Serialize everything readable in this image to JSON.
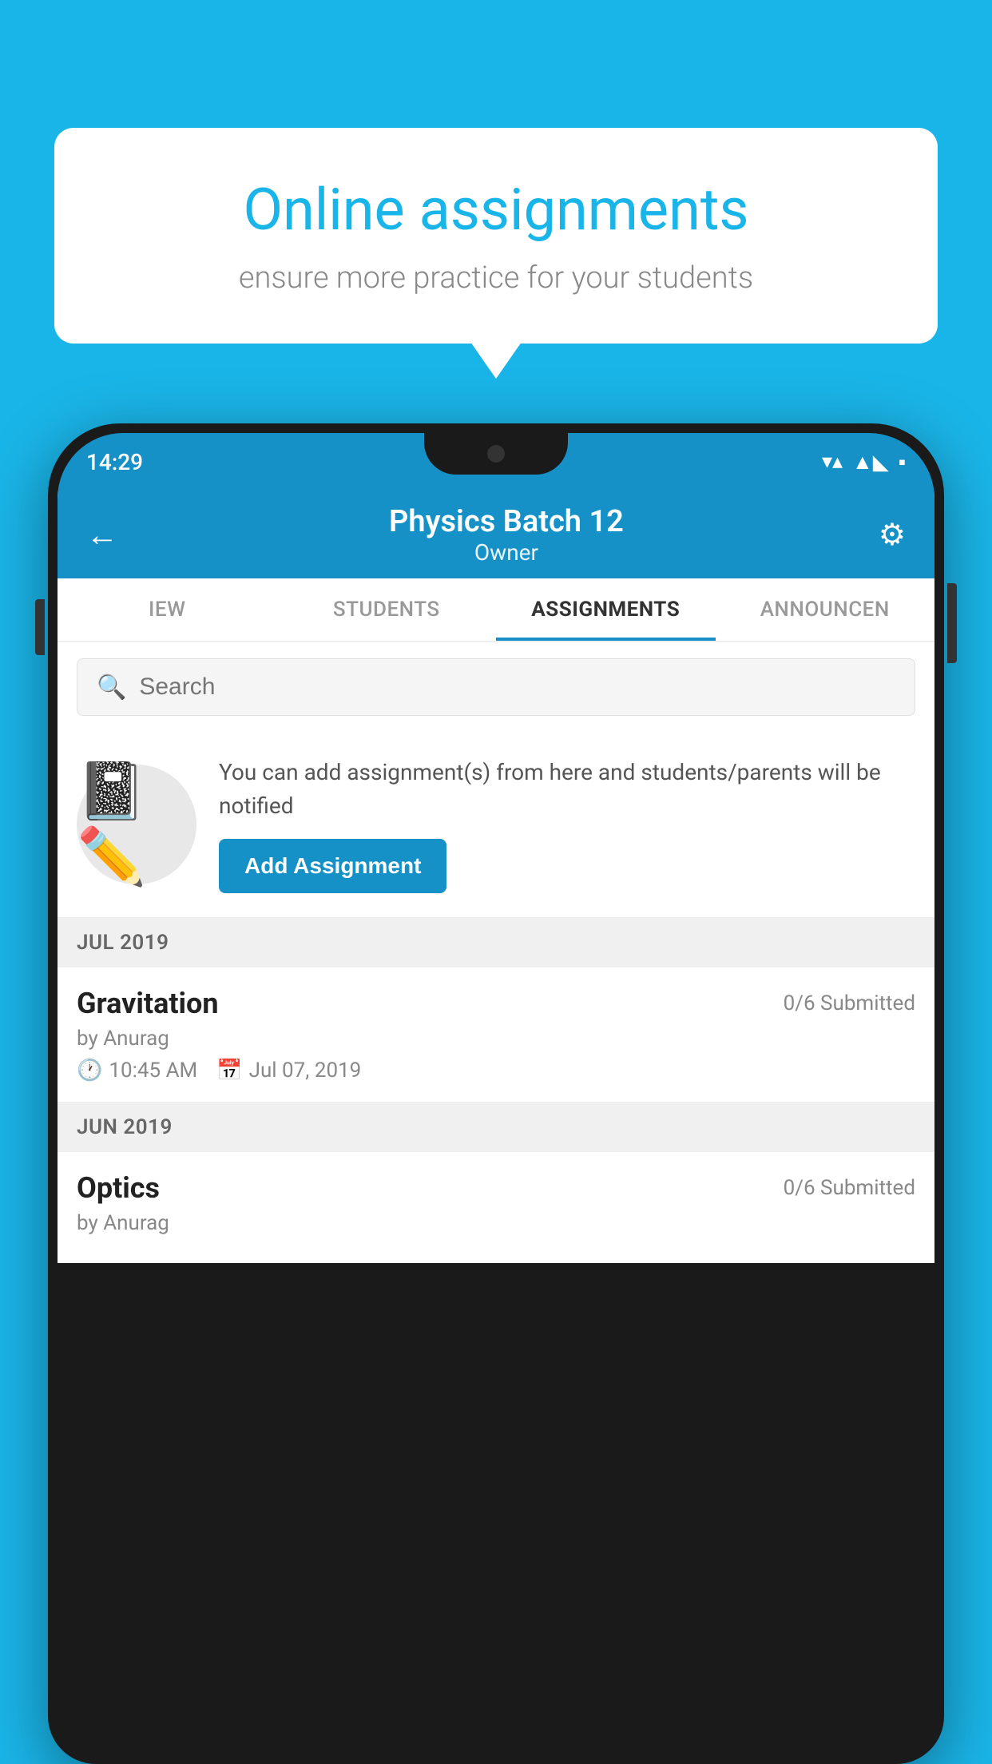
{
  "background_color": "#1ab5e8",
  "bubble": {
    "title": "Online assignments",
    "subtitle": "ensure more practice for your students"
  },
  "phone": {
    "status_bar": {
      "time": "14:29",
      "icons": [
        "wifi",
        "signal",
        "battery"
      ]
    },
    "header": {
      "title": "Physics Batch 12",
      "subtitle": "Owner",
      "back_label": "←",
      "settings_label": "⚙"
    },
    "tabs": [
      {
        "label": "IEW",
        "active": false
      },
      {
        "label": "STUDENTS",
        "active": false
      },
      {
        "label": "ASSIGNMENTS",
        "active": true
      },
      {
        "label": "ANNOUNCEN",
        "active": false
      }
    ],
    "search": {
      "placeholder": "Search"
    },
    "add_assignment": {
      "description": "You can add assignment(s) from here and students/parents will be notified",
      "button_label": "Add Assignment"
    },
    "sections": [
      {
        "label": "JUL 2019",
        "assignments": [
          {
            "name": "Gravitation",
            "submitted": "0/6 Submitted",
            "by": "by Anurag",
            "time": "10:45 AM",
            "date": "Jul 07, 2019"
          }
        ]
      },
      {
        "label": "JUN 2019",
        "assignments": [
          {
            "name": "Optics",
            "submitted": "0/6 Submitted",
            "by": "by Anurag",
            "time": "",
            "date": ""
          }
        ]
      }
    ]
  }
}
